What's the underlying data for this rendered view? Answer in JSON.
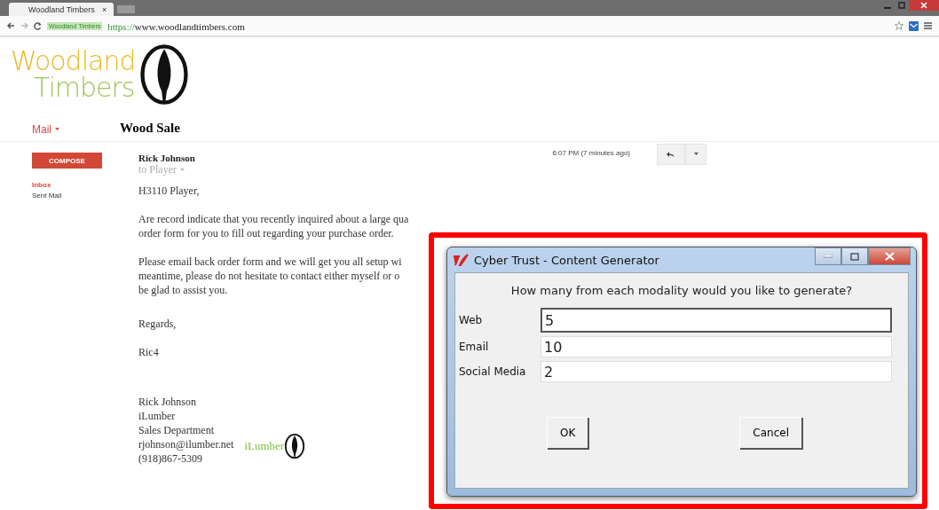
{
  "browser": {
    "tabs": [
      {
        "label": "Woodland Timbers",
        "close": "×",
        "selected": true
      }
    ],
    "address": {
      "identity": "Woodland Timbers",
      "scheme": "https://",
      "host": "www.woodlandtimbers.com"
    }
  },
  "site": {
    "logo_line_1": "Woodland",
    "logo_line_2": "Timbers"
  },
  "mail": {
    "menu": "Mail",
    "subject": "Wood Sale",
    "compose": "COMPOSE",
    "folders": [
      {
        "label": "Inbox",
        "selected": true
      },
      {
        "label": "Sent Mail",
        "selected": false
      }
    ],
    "message": {
      "sender": "Rick Johnson",
      "recipient": "to Player",
      "time": "6:07 PM (7 minutes ago)",
      "greeting": "H3110 Player,",
      "paragraphs": [
        [
          "Are record indicate that you recently inquired about a large qua",
          "order form for you to fill out regarding your purchase order."
        ],
        [
          "Please email back order form and we will get you all setup wi",
          "meantime, please do not hesitate to contact either myself or o",
          "be glad to assist you."
        ]
      ],
      "closing": "Regards,",
      "name": "Ric4",
      "signature": [
        "Rick Johnson",
        "iLumber",
        "Sales Department",
        "rjohnson@ilumber.net",
        "(918)867-5309"
      ],
      "signature_logo": "iLumber"
    }
  },
  "dialog": {
    "title": "Cyber Trust - Content Generator",
    "question": "How many from each modality would you like to generate?",
    "fields": [
      {
        "label": "Web",
        "value": "5",
        "focused": true
      },
      {
        "label": "Email",
        "value": "10",
        "focused": false
      },
      {
        "label": "Social Media",
        "value": "2",
        "focused": false
      }
    ],
    "buttons": [
      "OK",
      "Cancel"
    ]
  }
}
